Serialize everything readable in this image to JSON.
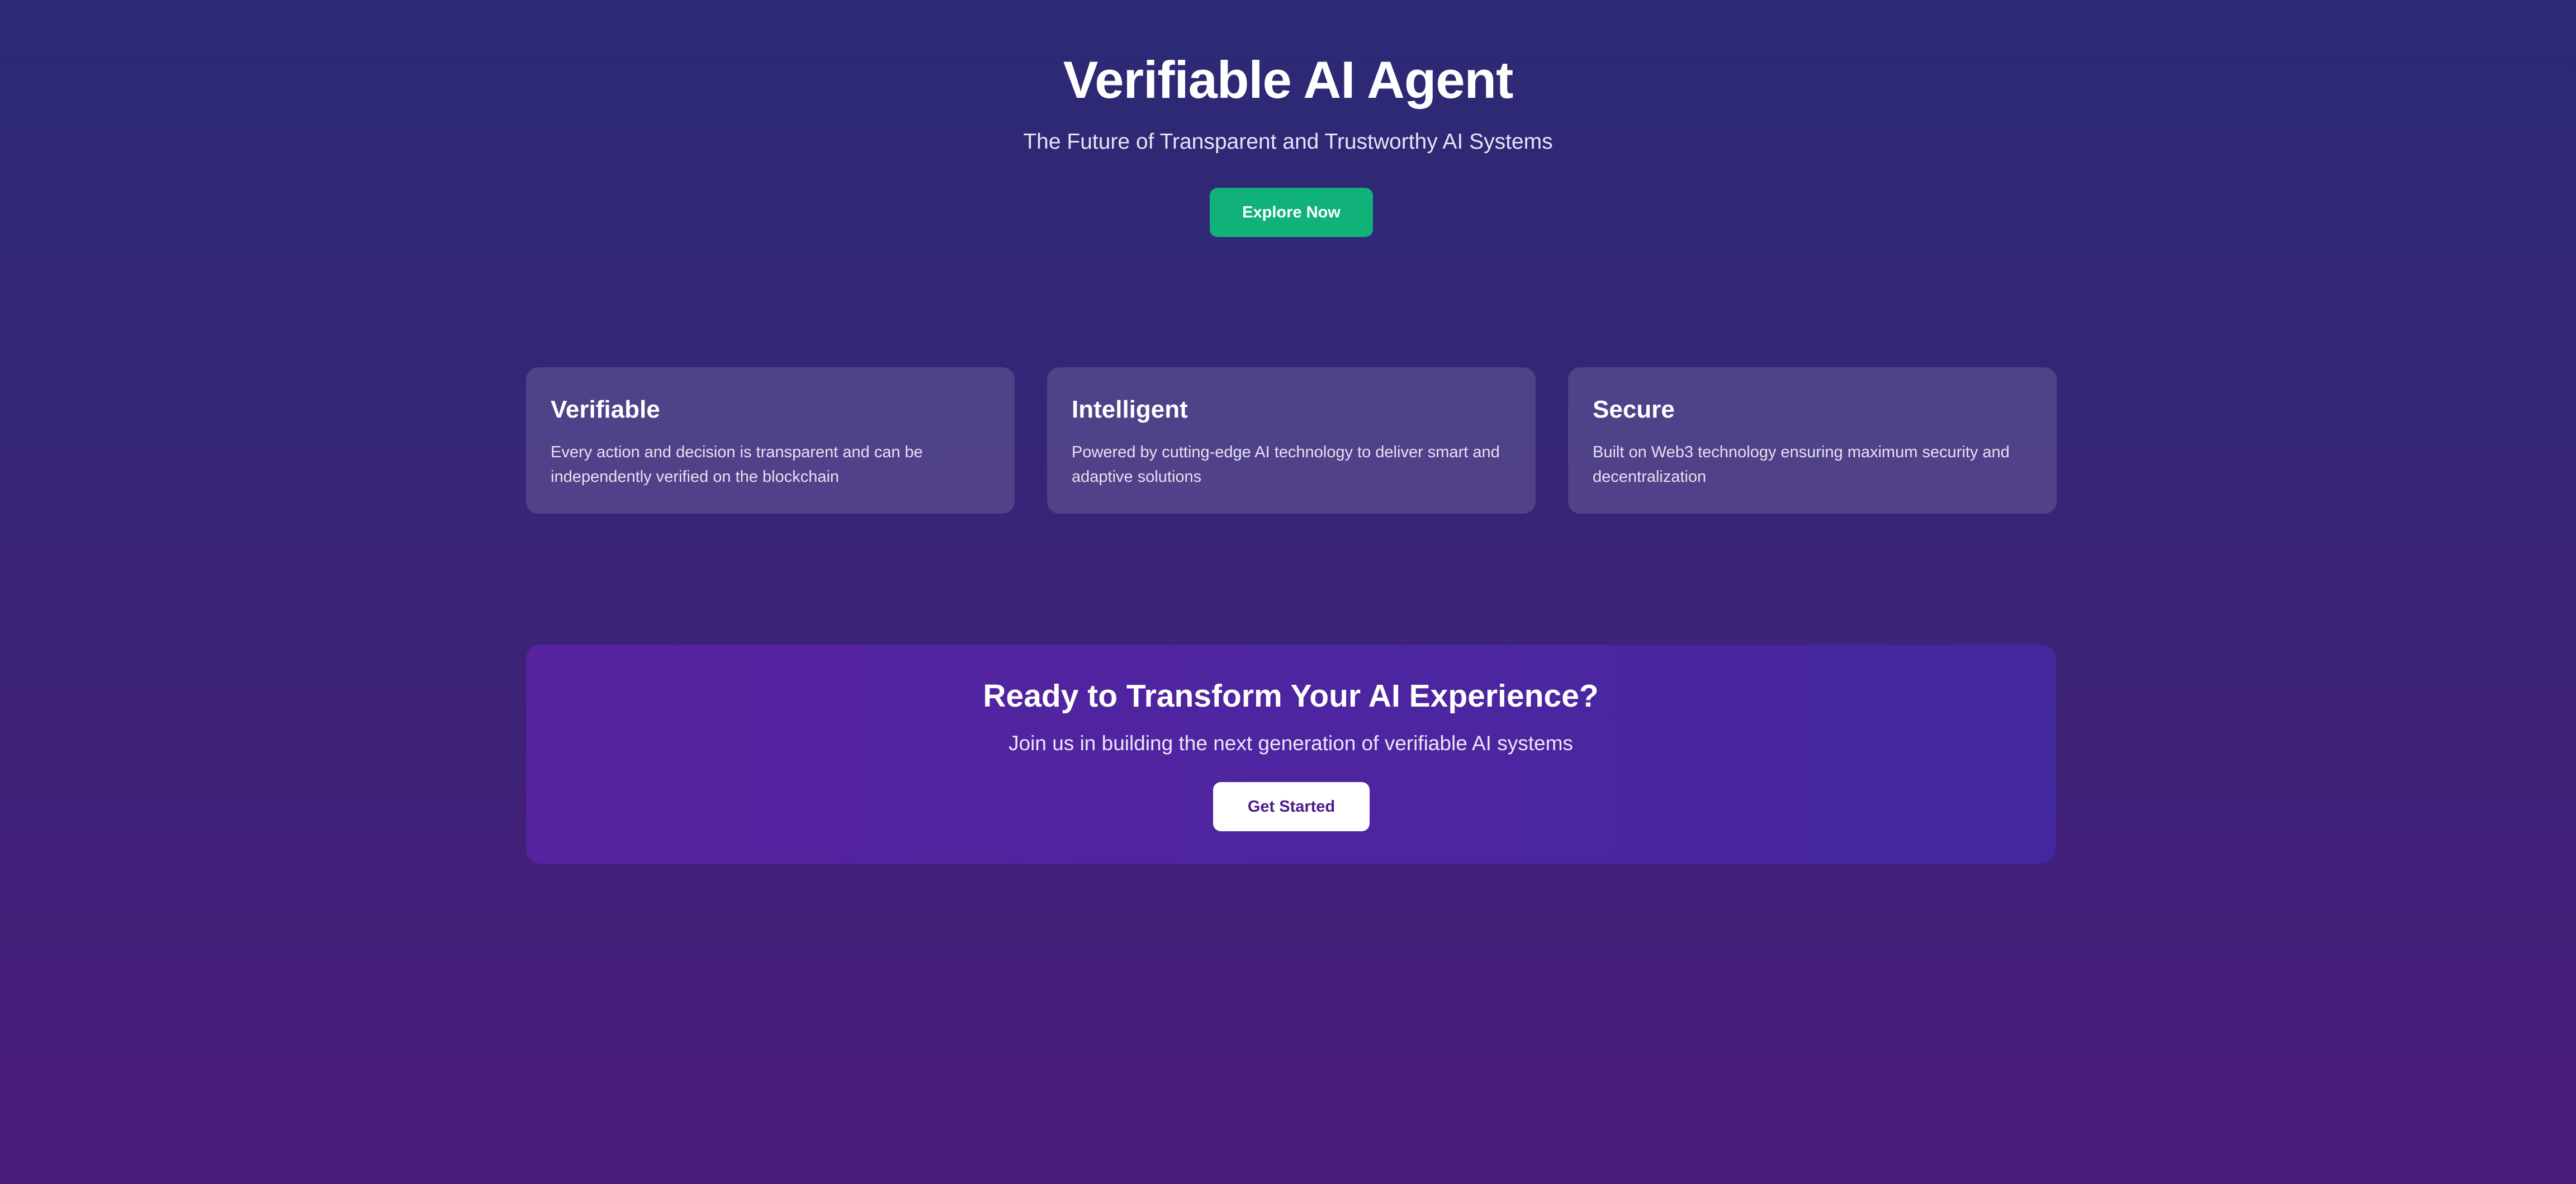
{
  "hero": {
    "title": "Verifiable AI Agent",
    "subtitle": "The Future of Transparent and Trustworthy AI Systems",
    "button_label": "Explore Now"
  },
  "features": [
    {
      "title": "Verifiable",
      "description": "Every action and decision is transparent and can be independently verified on the blockchain"
    },
    {
      "title": "Intelligent",
      "description": "Powered by cutting-edge AI technology to deliver smart and adaptive solutions"
    },
    {
      "title": "Secure",
      "description": "Built on Web3 technology ensuring maximum security and decentralization"
    }
  ],
  "cta": {
    "title": "Ready to Transform Your AI Experience?",
    "subtitle": "Join us in building the next generation of verifiable AI systems",
    "button_label": "Get Started"
  },
  "colors": {
    "background_top": "#2b2a74",
    "background_bottom": "#4b1c7a",
    "accent_green": "#10b27a",
    "cta_background": "#5123a0",
    "cta_button_text": "#4a1d86"
  }
}
